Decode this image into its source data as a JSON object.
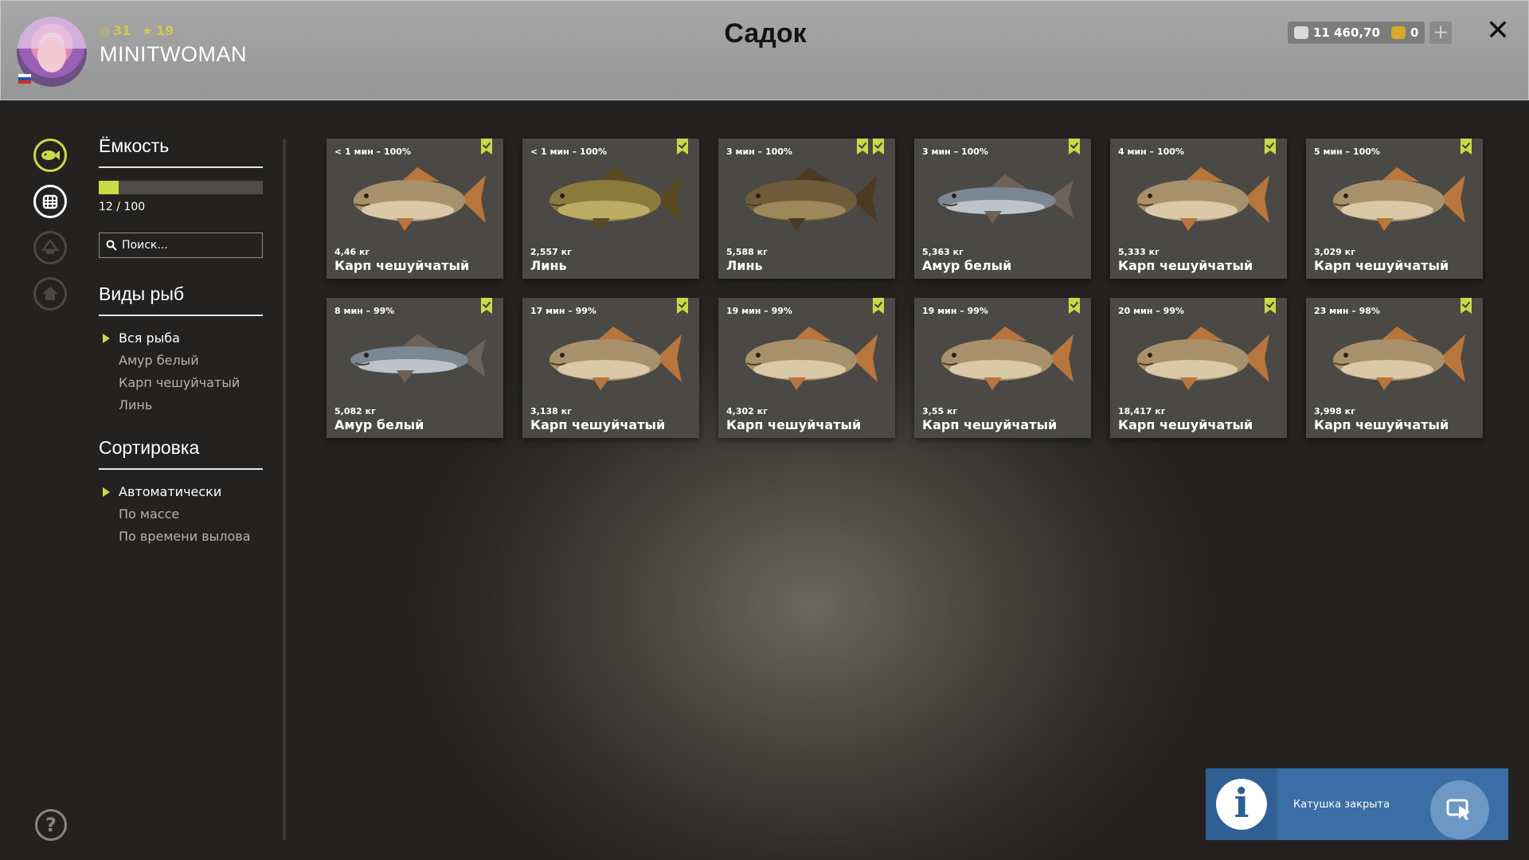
{
  "header": {
    "title": "Садок",
    "player": {
      "username": "MINITWOMAN",
      "level": "31",
      "rank": "19"
    },
    "silver": "11 460,70",
    "gold": "0"
  },
  "capacity": {
    "heading": "Ёмкость",
    "current": 12,
    "max": 100,
    "label": "12 / 100"
  },
  "search": {
    "placeholder": "Поиск..."
  },
  "species": {
    "heading": "Виды рыб",
    "items": [
      "Вся рыба",
      "Амур белый",
      "Карп чешуйчатый",
      "Линь"
    ],
    "selected_index": 0
  },
  "sorting": {
    "heading": "Сортировка",
    "items": [
      "Автоматически",
      "По массе",
      "По времени вылова"
    ],
    "selected_index": 0
  },
  "fish": [
    {
      "time": "< 1 мин – 100%",
      "weight": "4,46 кг",
      "name": "Карп чешуйчатый",
      "kind": "carp",
      "star": false
    },
    {
      "time": "< 1 мин – 100%",
      "weight": "2,557 кг",
      "name": "Линь",
      "kind": "tench",
      "star": false
    },
    {
      "time": "3 мин – 100%",
      "weight": "5,588 кг",
      "name": "Линь",
      "kind": "tench-dark",
      "star": true
    },
    {
      "time": "3 мин – 100%",
      "weight": "5,363 кг",
      "name": "Амур белый",
      "kind": "amur",
      "star": false
    },
    {
      "time": "4 мин – 100%",
      "weight": "5,333 кг",
      "name": "Карп чешуйчатый",
      "kind": "carp",
      "star": false
    },
    {
      "time": "5 мин – 100%",
      "weight": "3,029 кг",
      "name": "Карп чешуйчатый",
      "kind": "carp",
      "star": false
    },
    {
      "time": "8 мин – 99%",
      "weight": "5,082 кг",
      "name": "Амур белый",
      "kind": "amur",
      "star": false
    },
    {
      "time": "17 мин – 99%",
      "weight": "3,138 кг",
      "name": "Карп чешуйчатый",
      "kind": "carp",
      "star": false
    },
    {
      "time": "19 мин – 99%",
      "weight": "4,302 кг",
      "name": "Карп чешуйчатый",
      "kind": "carp",
      "star": false
    },
    {
      "time": "19 мин – 99%",
      "weight": "3,55 кг",
      "name": "Карп чешуйчатый",
      "kind": "carp",
      "star": false
    },
    {
      "time": "20 мин – 99%",
      "weight": "18,417 кг",
      "name": "Карп чешуйчатый",
      "kind": "carp",
      "star": false
    },
    {
      "time": "23 мин – 98%",
      "weight": "3,998 кг",
      "name": "Карп чешуйчатый",
      "kind": "carp",
      "star": false
    }
  ],
  "notification": {
    "text": "Катушка закрыта",
    "icon": "info-icon",
    "action_icon": "cursor-click-icon"
  },
  "icons": {
    "rail": [
      "fish-icon",
      "keepnet-icon",
      "tackle-icon",
      "home-icon"
    ],
    "help": "help-icon"
  },
  "colors": {
    "accent": "#c9d948",
    "level": "#d6c94a",
    "notify": "#3a6ea5"
  }
}
